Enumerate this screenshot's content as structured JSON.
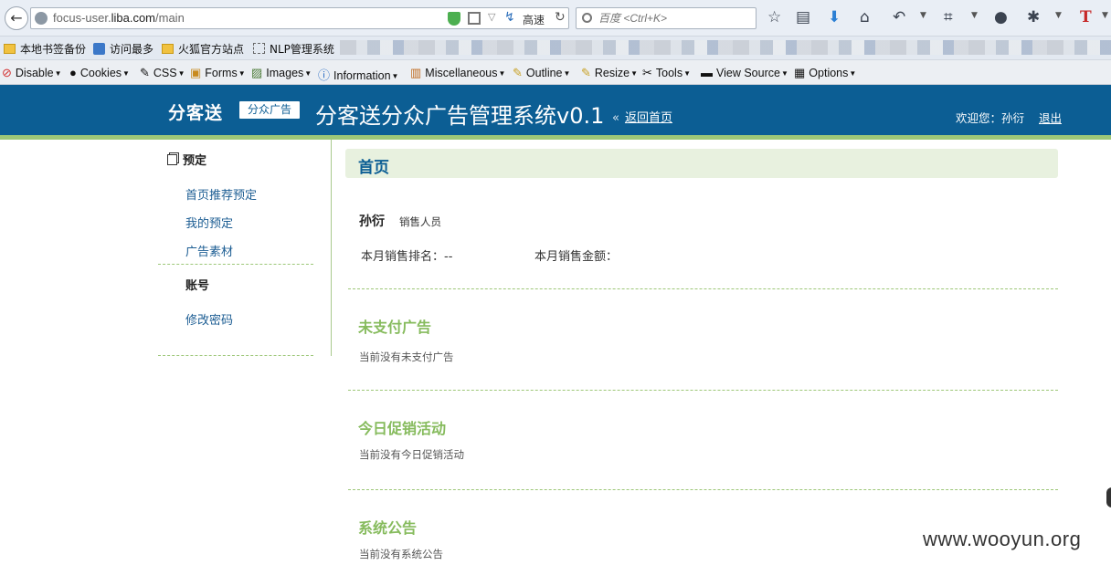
{
  "browser": {
    "url_host_prefix": "focus-user.",
    "url_host_main": "liba.com",
    "url_path": "/main",
    "speed_label": "高速",
    "search_placeholder": "百度 <Ctrl+K>"
  },
  "bookmarks": [
    {
      "label": "本地书签备份",
      "icon": "folder-icon"
    },
    {
      "label": "访问最多",
      "icon": "page-icon"
    },
    {
      "label": "火狐官方站点",
      "icon": "folder-icon"
    },
    {
      "label": "NLP管理系统",
      "icon": "dotted-page-icon"
    }
  ],
  "dev_toolbar": [
    {
      "label": "Disable",
      "icon": "disable-icon"
    },
    {
      "label": "Cookies",
      "icon": "cookies-icon"
    },
    {
      "label": "CSS",
      "icon": "css-icon"
    },
    {
      "label": "Forms",
      "icon": "forms-icon"
    },
    {
      "label": "Images",
      "icon": "images-icon"
    },
    {
      "label": "Information",
      "icon": "info-icon"
    },
    {
      "label": "Miscellaneous",
      "icon": "misc-icon"
    },
    {
      "label": "Outline",
      "icon": "outline-icon"
    },
    {
      "label": "Resize",
      "icon": "resize-icon"
    },
    {
      "label": "Tools",
      "icon": "tools-icon"
    },
    {
      "label": "View Source",
      "icon": "view-source-icon"
    },
    {
      "label": "Options",
      "icon": "options-icon"
    }
  ],
  "header": {
    "logo": "分客送",
    "badge": "分众广告",
    "title": "分客送分众广告管理系统v0.1",
    "back_icon": "«",
    "back_home": "返回首页",
    "welcome": "欢迎您：孙衍",
    "logout": "退出",
    "colors": {
      "header_bg": "#0c5e94",
      "accent_green": "#86bb5d"
    }
  },
  "sidebar": {
    "sections": [
      {
        "heading": "预定",
        "icon": "copy-icon",
        "items": [
          "首页推荐预定",
          "我的预定",
          "广告素材"
        ]
      },
      {
        "heading": "账号",
        "items": [
          "修改密码"
        ]
      }
    ]
  },
  "main": {
    "page_title": "首页",
    "user": {
      "name": "孙衍",
      "role": "销售人员"
    },
    "stats": {
      "rank_label": "本月销售排名：--",
      "amount_label": "本月销售金额："
    },
    "sections": [
      {
        "title": "未支付广告",
        "empty": "当前没有未支付广告"
      },
      {
        "title": "今日促销活动",
        "empty": "当前没有今日促销活动"
      },
      {
        "title": "系统公告",
        "empty": "当前没有系统公告"
      }
    ]
  },
  "watermark": "www.wooyun.org"
}
